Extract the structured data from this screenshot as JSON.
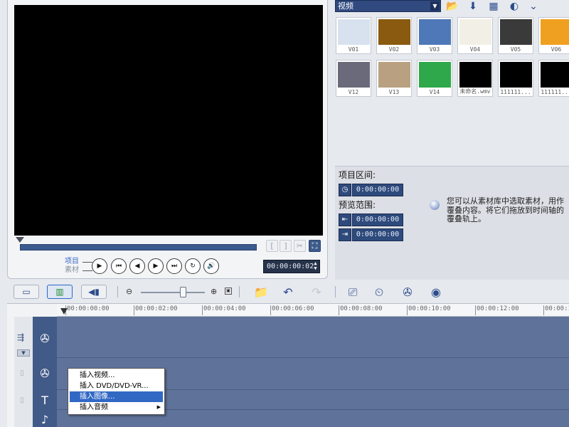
{
  "preview": {
    "mode_project": "项目",
    "mode_clip": "素材",
    "trim_start": "[",
    "trim_end": "]",
    "timecode": "00:00:00:02"
  },
  "library": {
    "category": "视频",
    "thumbnails": [
      {
        "caption": "V01",
        "color": "#d8e2ee"
      },
      {
        "caption": "V02",
        "color": "#8a5a10"
      },
      {
        "caption": "V03",
        "color": "#4f78b8"
      },
      {
        "caption": "V04",
        "color": "#f2efe6"
      },
      {
        "caption": "V05",
        "color": "#3a3a3a"
      },
      {
        "caption": "V06",
        "color": "#f0a020"
      },
      {
        "caption": "V12",
        "color": "#6a6a7a"
      },
      {
        "caption": "V13",
        "color": "#b8a080"
      },
      {
        "caption": "V14",
        "color": "#2ea84a"
      },
      {
        "caption": "未命名.wmv",
        "color": "#000000"
      },
      {
        "caption": "111111...",
        "color": "#000000"
      },
      {
        "caption": "111111...",
        "color": "#000000"
      }
    ]
  },
  "options": {
    "project_duration_label": "项目区间:",
    "project_duration": "0:00:00:00",
    "preview_range_label": "预览范围:",
    "range_start": "0:00:00:00",
    "range_end": "0:00:00:00",
    "hint": "您可以从素材库中选取素材，用作覆叠内容。将它们拖放到时间轴的覆叠轨上。"
  },
  "timeline": {
    "ticks": [
      "00:00:00:00",
      "00:00:02:00",
      "00:00:04:00",
      "00:00:06:00",
      "00:00:08:00",
      "00:00:10:00",
      "00:00:12:00",
      "00:00:14:00"
    ]
  },
  "context_menu": {
    "items": [
      {
        "label": "插入视频..."
      },
      {
        "label": "插入 DVD/DVD-VR..."
      },
      {
        "label": "插入图像..."
      },
      {
        "label": "插入音频"
      }
    ]
  },
  "colors": {
    "accent": "#3168c4",
    "track_bg": "#5f7299",
    "timecode_bg": "#27334a"
  }
}
